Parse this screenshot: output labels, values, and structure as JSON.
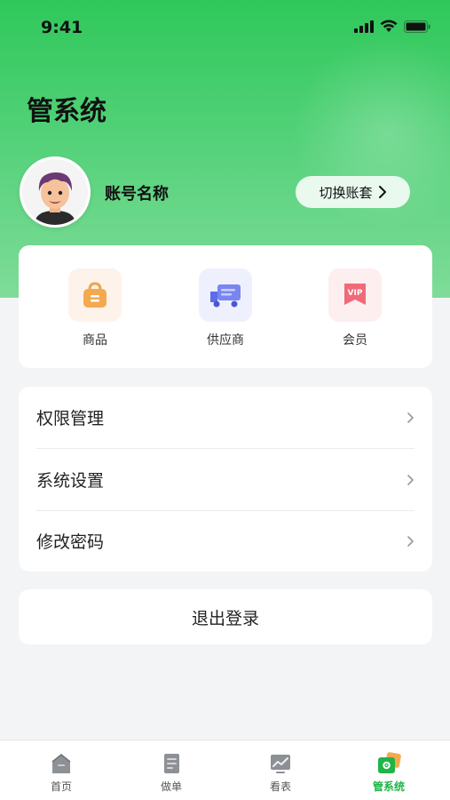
{
  "status_bar": {
    "time": "9:41"
  },
  "header": {
    "title": "管系统"
  },
  "account": {
    "name": "账号名称",
    "switch_label": "切换账套"
  },
  "quick_actions": [
    {
      "label": "商品",
      "icon": "shopping-bag-icon"
    },
    {
      "label": "供应商",
      "icon": "truck-icon"
    },
    {
      "label": "会员",
      "icon": "vip-badge-icon",
      "badge_text": "VIP"
    }
  ],
  "menu": [
    {
      "label": "权限管理",
      "icon": "chevron-right-icon"
    },
    {
      "label": "系统设置",
      "icon": "chevron-right-icon"
    },
    {
      "label": "修改密码",
      "icon": "chevron-right-icon"
    }
  ],
  "logout": {
    "label": "退出登录"
  },
  "tabbar": [
    {
      "label": "首页",
      "icon": "home-icon",
      "active": false
    },
    {
      "label": "做单",
      "icon": "document-icon",
      "active": false
    },
    {
      "label": "看表",
      "icon": "chart-icon",
      "active": false
    },
    {
      "label": "管系统",
      "icon": "settings-icon",
      "active": true
    }
  ],
  "colors": {
    "brand_green": "#2fc85a",
    "active_tab": "#1fb548",
    "switch_button_bg": "#e9f9ee",
    "page_bg": "#f3f4f6"
  }
}
